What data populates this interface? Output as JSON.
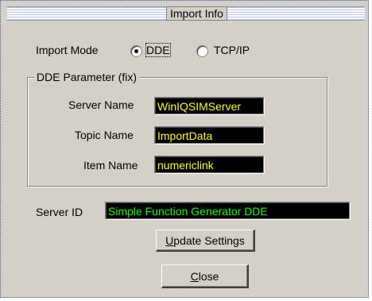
{
  "window": {
    "title": "Import Info"
  },
  "import_mode": {
    "label": "Import Mode",
    "options": [
      {
        "label": "DDE",
        "selected": true
      },
      {
        "label": "TCP/IP",
        "selected": false
      }
    ]
  },
  "dde_group": {
    "title": "DDE Parameter (fix)",
    "fields": [
      {
        "label": "Server Name",
        "value": "WinIQSIMServer"
      },
      {
        "label": "Topic Name",
        "value": "ImportData"
      },
      {
        "label": "Item Name",
        "value": "numericlink"
      }
    ]
  },
  "server_id": {
    "label": "Server ID",
    "value": "Simple Function Generator DDE"
  },
  "buttons": {
    "update": {
      "accel": "U",
      "rest": "pdate Settings"
    },
    "close": {
      "accel": "C",
      "rest": "lose"
    }
  },
  "colors": {
    "field_text": "#ffff00",
    "server_id_text": "#00ff00",
    "field_bg": "#000000",
    "dialog_bg": "#d4d0c8"
  }
}
